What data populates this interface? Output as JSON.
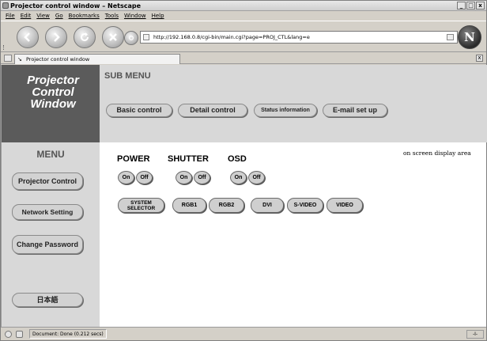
{
  "window": {
    "title": "Projector control window – Netscape",
    "controls": [
      "_",
      "□",
      "x"
    ]
  },
  "menubar": [
    "File",
    "Edit",
    "View",
    "Go",
    "Bookmarks",
    "Tools",
    "Window",
    "Help"
  ],
  "toolbar": {
    "url": "http://192.168.0.8/cgi-bin/main.cgi?page=PROJ_CTL&lang=e",
    "logo_letter": "N"
  },
  "tab": {
    "label": "Projector control window",
    "close": "x"
  },
  "page": {
    "logo_lines": [
      "Projector",
      "Control",
      "Window"
    ],
    "submenu": {
      "title": "SUB MENU",
      "items": [
        "Basic control",
        "Detail control",
        "Status information",
        "E-mail set up"
      ]
    },
    "menu": {
      "title": "MENU",
      "items": [
        "Projector Control",
        "Network Setting",
        "Change Password",
        "日本語"
      ]
    },
    "controls": {
      "power": {
        "label": "POWER",
        "on": "On",
        "off": "Off"
      },
      "shutter": {
        "label": "SHUTTER",
        "on": "On",
        "off": "Off"
      },
      "osd": {
        "label": "OSD",
        "on": "On",
        "off": "Off"
      }
    },
    "sources": [
      "SYSTEM SELECTOR",
      "RGB1",
      "RGB2",
      "DVI",
      "S-VIDEO",
      "VIDEO"
    ],
    "osd_note": "on screen display area"
  },
  "status": {
    "text": "Document: Done (0.212 secs)",
    "right": "-I-"
  },
  "colors": {
    "logo_bg": "#5b5b5b",
    "panel_bg": "#d8d8d8",
    "content_bg": "#ffffff"
  }
}
